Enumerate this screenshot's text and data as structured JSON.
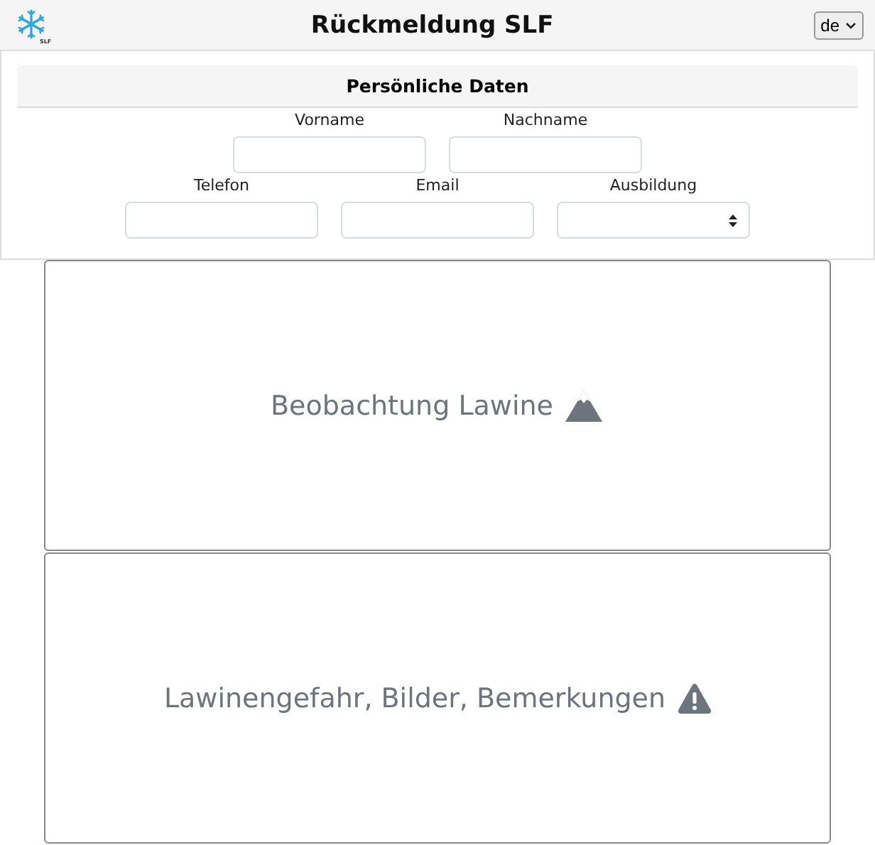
{
  "header": {
    "logo_text": "SLF",
    "title": "Rückmeldung SLF",
    "language": "de"
  },
  "personal": {
    "title": "Persönliche Daten",
    "rows": [
      [
        {
          "label": "Vorname",
          "kind": "text"
        },
        {
          "label": "Nachname",
          "kind": "text"
        }
      ],
      [
        {
          "label": "Telefon",
          "kind": "text"
        },
        {
          "label": "Email",
          "kind": "text"
        },
        {
          "label": "Ausbildung",
          "kind": "select"
        }
      ]
    ]
  },
  "cards": [
    {
      "label": "Beobachtung Lawine",
      "kind": "mountain"
    },
    {
      "label": "Lawinengefahr, Bilder, Bemerkungen",
      "kind": "warning"
    }
  ]
}
